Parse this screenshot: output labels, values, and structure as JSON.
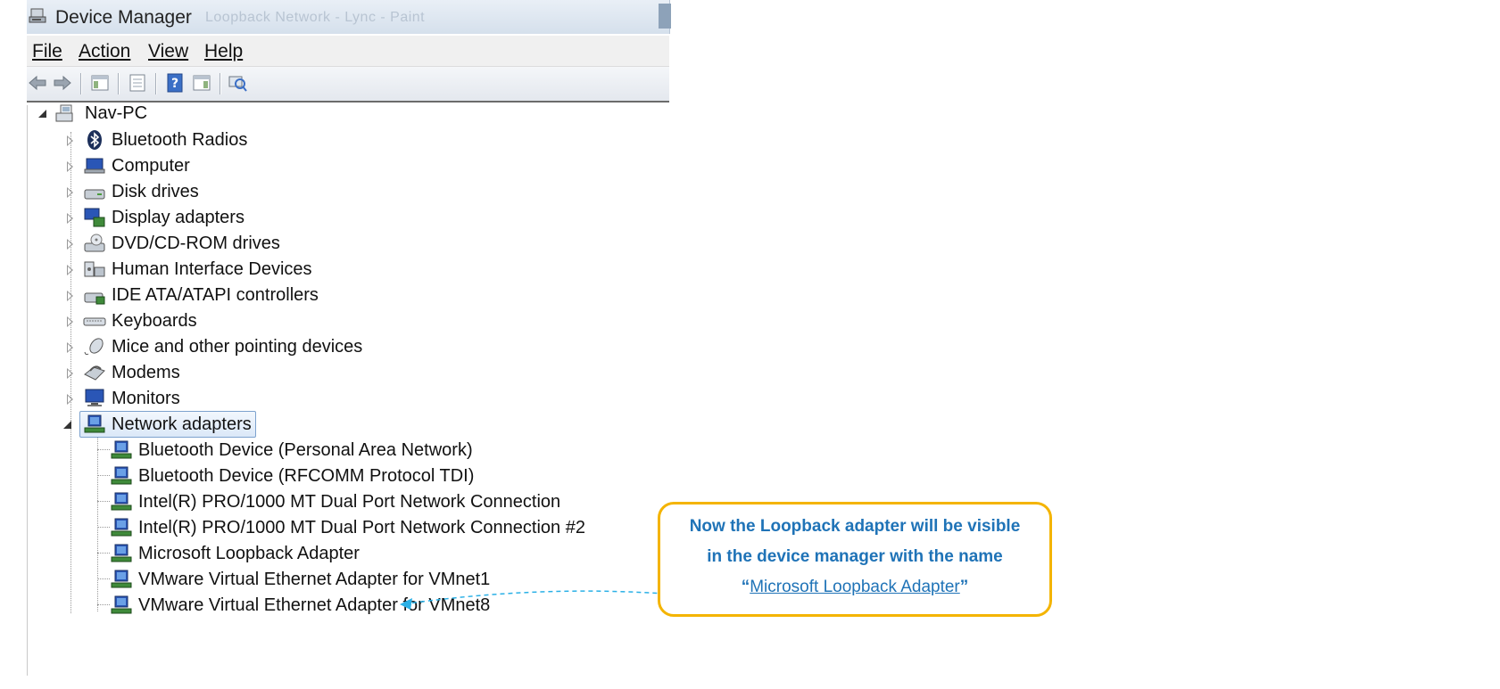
{
  "window": {
    "title": "Device Manager",
    "ghost_title": "Loopback Network - Lync - Paint"
  },
  "menu": [
    {
      "label": "File"
    },
    {
      "label": "Action"
    },
    {
      "label": "View"
    },
    {
      "label": "Help"
    }
  ],
  "toolbar": [
    "back-icon",
    "forward-icon",
    "show-hide-console-tree-icon",
    "properties-icon",
    "help-icon",
    "action-pane-icon",
    "scan-hardware-icon"
  ],
  "tree": {
    "root": "Nav-PC",
    "categories": [
      {
        "label": "Bluetooth Radios",
        "icon": "bluetooth-icon",
        "expanded": false
      },
      {
        "label": "Computer",
        "icon": "computer-icon",
        "expanded": false
      },
      {
        "label": "Disk drives",
        "icon": "disk-drive-icon",
        "expanded": false
      },
      {
        "label": "Display adapters",
        "icon": "display-adapter-icon",
        "expanded": false
      },
      {
        "label": "DVD/CD-ROM drives",
        "icon": "dvd-drive-icon",
        "expanded": false
      },
      {
        "label": "Human Interface Devices",
        "icon": "hid-icon",
        "expanded": false
      },
      {
        "label": "IDE ATA/ATAPI controllers",
        "icon": "ide-controller-icon",
        "expanded": false
      },
      {
        "label": "Keyboards",
        "icon": "keyboard-icon",
        "expanded": false
      },
      {
        "label": "Mice and other pointing devices",
        "icon": "mouse-icon",
        "expanded": false
      },
      {
        "label": "Modems",
        "icon": "modem-icon",
        "expanded": false
      },
      {
        "label": "Monitors",
        "icon": "monitor-icon",
        "expanded": false
      },
      {
        "label": "Network adapters",
        "icon": "network-adapter-icon",
        "expanded": true,
        "selected": true
      }
    ],
    "network_adapters": [
      "Bluetooth Device (Personal Area Network)",
      "Bluetooth Device (RFCOMM Protocol TDI)",
      "Intel(R) PRO/1000 MT Dual Port Network Connection",
      "Intel(R) PRO/1000 MT Dual Port Network Connection #2",
      "Microsoft Loopback Adapter",
      "VMware Virtual Ethernet Adapter for VMnet1",
      "VMware Virtual Ethernet Adapter for VMnet8"
    ]
  },
  "callout": {
    "line1": "Now the Loopback adapter will be visible",
    "line2": "in the device manager with the name",
    "quote_open": "“",
    "link_text": "Microsoft Loopback Adapter",
    "quote_close": "”",
    "border_color": "#f4b400",
    "text_color": "#1f73b7"
  }
}
